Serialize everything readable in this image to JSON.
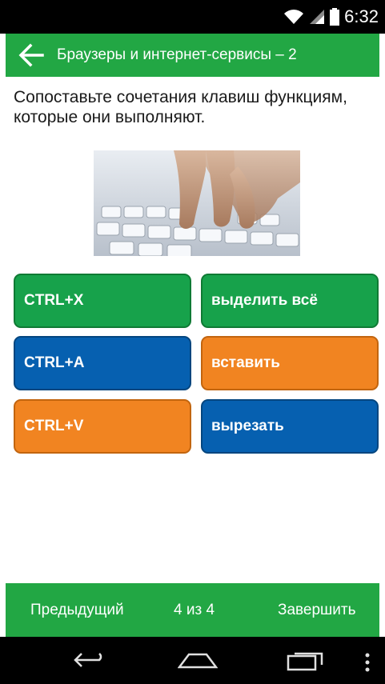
{
  "status_bar": {
    "time": "6:32",
    "icons": [
      "wifi-icon",
      "signal-icon",
      "battery-icon"
    ]
  },
  "header": {
    "title": "Браузеры и интернет-сервисы – 2",
    "back_icon": "arrow-left-icon"
  },
  "question": {
    "text": "Сопоставьте сочетания клавиш функциям, которые они выполняют."
  },
  "image": {
    "description_icon": "keyboard-photo"
  },
  "left_tiles": [
    {
      "label": "CTRL+X",
      "color": "green"
    },
    {
      "label": "CTRL+A",
      "color": "blue"
    },
    {
      "label": "CTRL+V",
      "color": "orange"
    }
  ],
  "right_tiles": [
    {
      "label": "выделить всё",
      "color": "green"
    },
    {
      "label": "вставить",
      "color": "orange"
    },
    {
      "label": "вырезать",
      "color": "blue"
    }
  ],
  "footer": {
    "prev_label": "Предыдущий",
    "progress": "4 из 4",
    "finish_label": "Завершить"
  },
  "colors": {
    "app_green": "#22a744",
    "tile_green": "#17a24b",
    "tile_blue": "#0660b0",
    "tile_orange": "#f18421"
  },
  "nav_bar": {
    "icons": [
      "back-nav-icon",
      "home-nav-icon",
      "recents-nav-icon",
      "menu-dots-icon"
    ]
  }
}
